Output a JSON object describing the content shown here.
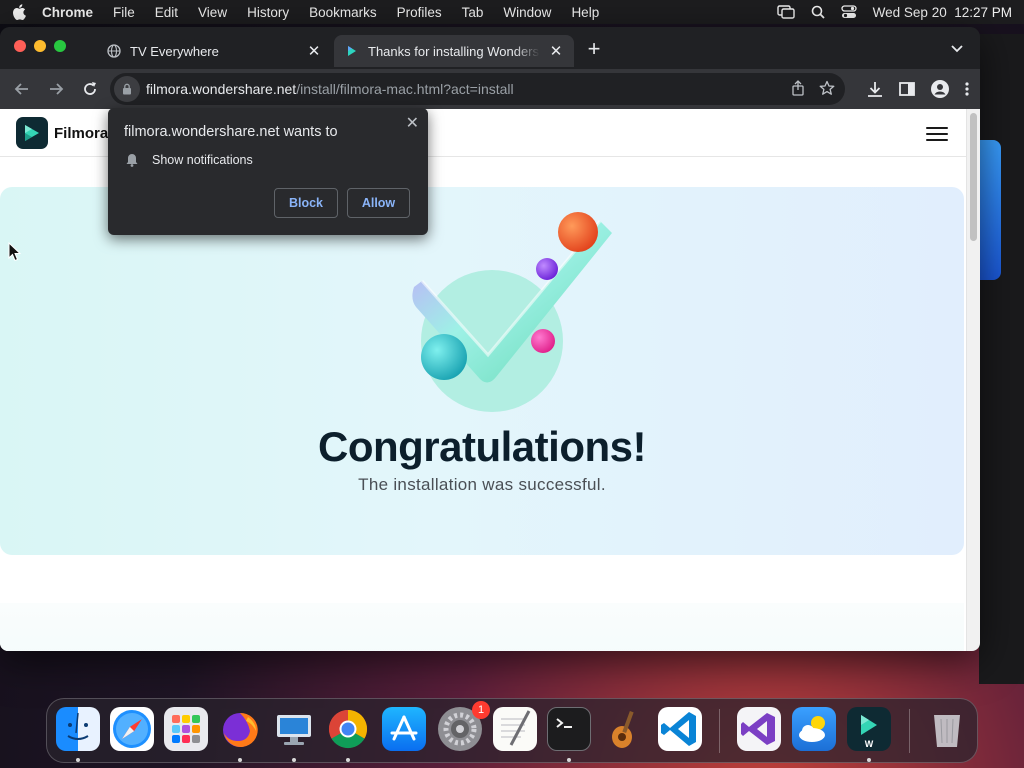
{
  "menubar": {
    "app_name": "Chrome",
    "items": [
      "File",
      "Edit",
      "View",
      "History",
      "Bookmarks",
      "Profiles",
      "Tab",
      "Window",
      "Help"
    ],
    "clock": "Wed Sep 20  12:27 PM"
  },
  "tabs": [
    {
      "title": "TV Everywhere",
      "icon": "globe-icon",
      "active": false
    },
    {
      "title": "Thanks for installing Wondershare",
      "icon": "filmora-icon",
      "active": true
    }
  ],
  "toolbar": {
    "url_host": "filmora.wondershare.net",
    "url_path": "/install/filmora-mac.html?act=install"
  },
  "permission_prompt": {
    "title": "filmora.wondershare.net wants to",
    "permission": "Show notifications",
    "block_label": "Block",
    "allow_label": "Allow"
  },
  "site": {
    "brand": "Filmora",
    "hero_title": "Congratulations!",
    "hero_subtitle": "The installation was successful."
  },
  "dock": {
    "apps": [
      "Finder",
      "Safari",
      "Launchpad",
      "Firefox",
      "Remote Desktop",
      "Chrome",
      "App Store",
      "System Settings",
      "TextEdit",
      "Terminal",
      "GarageBand",
      "VS Code",
      "Visual Studio",
      "Weather",
      "Filmora",
      "Trash"
    ],
    "system_settings_badge": "1"
  },
  "colors": {
    "chrome_dark": "#202124",
    "chrome_toolbar": "#35363a",
    "link_blue": "#8ab4f8",
    "hero_title": "#0c1f2c"
  }
}
